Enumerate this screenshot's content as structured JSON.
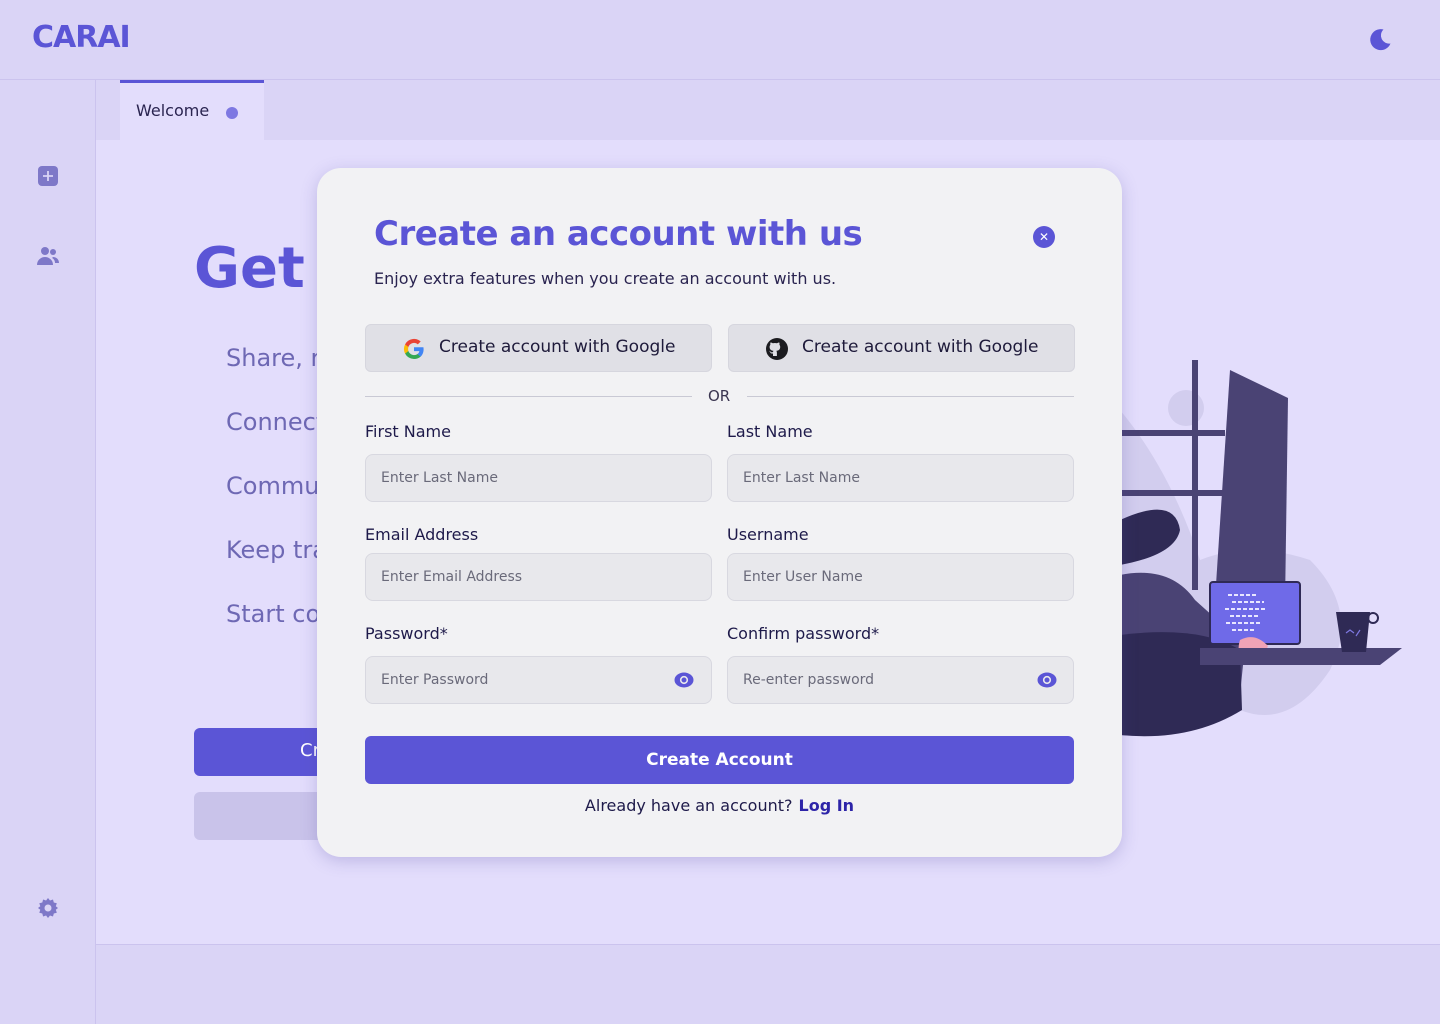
{
  "app": {
    "logo": "CARAI"
  },
  "header": {
    "theme_icon": "moon-icon"
  },
  "sidebar": {
    "icons": [
      "add-square-icon",
      "users-icon"
    ],
    "settings_icon": "gear-icon"
  },
  "tabs": [
    {
      "label": "Welcome",
      "dirty": true
    }
  ],
  "background": {
    "title": "Get S",
    "items": [
      "Share, re",
      "Connect",
      "Commu",
      "Keep tra",
      "Start co"
    ],
    "primary_button": "Cr"
  },
  "modal": {
    "title": "Create an account with us",
    "subtitle": "Enjoy extra features when you create an account with us.",
    "google_button": "Create account with Google",
    "github_button": "Create account with Google",
    "divider": "OR",
    "fields": {
      "first_name": {
        "label": "First Name",
        "placeholder": "Enter Last Name"
      },
      "last_name": {
        "label": "Last Name",
        "placeholder": "Enter Last Name"
      },
      "email": {
        "label": "Email Address",
        "placeholder": "Enter Email Address"
      },
      "username": {
        "label": "Username",
        "placeholder": "Enter User Name"
      },
      "password": {
        "label": "Password*",
        "placeholder": "Enter Password"
      },
      "confirm_password": {
        "label": "Confirm password*",
        "placeholder": "Re-enter password"
      }
    },
    "submit": "Create Account",
    "login_prompt": "Already have an account?",
    "login_link": "Log In"
  },
  "colors": {
    "accent": "#5b55d6",
    "background": "#e3ddfc",
    "panel": "#dad4f6",
    "modal": "#f2f2f4"
  }
}
